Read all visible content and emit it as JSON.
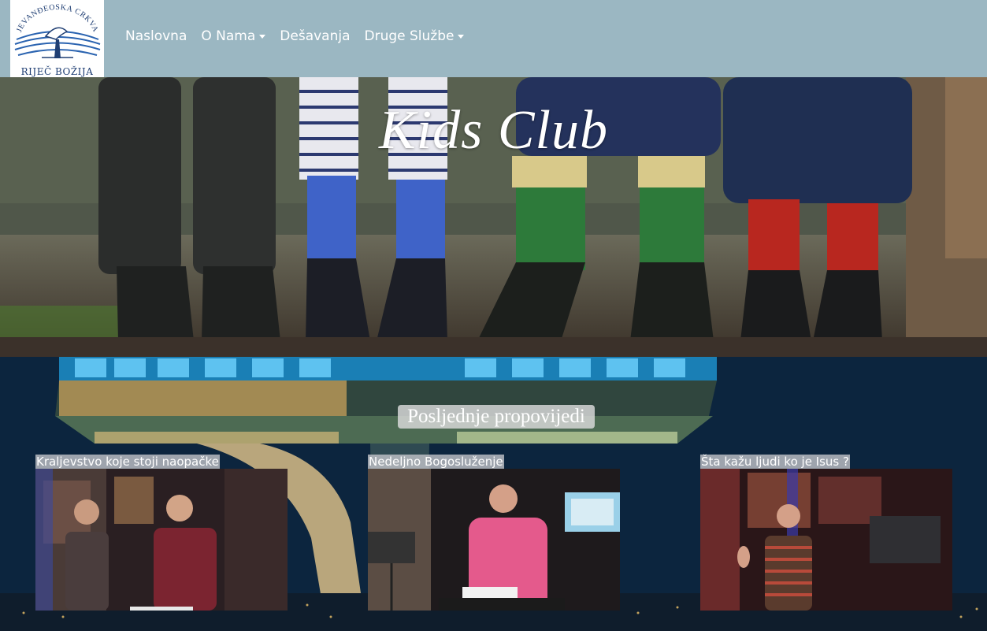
{
  "logo": {
    "arc_text": "JEVANĐEOSKA CRKVA",
    "bottom_text": "RIJEČ BOŽIJA"
  },
  "nav": {
    "items": [
      {
        "label": "Naslovna",
        "dropdown": false
      },
      {
        "label": "O Nama",
        "dropdown": true
      },
      {
        "label": "Dešavanja",
        "dropdown": false
      },
      {
        "label": "Druge Službe",
        "dropdown": true
      }
    ]
  },
  "hero": {
    "title": "Kids Club"
  },
  "sermons": {
    "heading": "Posljednje propovijedi",
    "items": [
      {
        "title": "Kraljevstvo koje stoji naopačke"
      },
      {
        "title": "Nedeljno Bogosluženje"
      },
      {
        "title": "Šta kažu ljudi ko je Isus ?"
      }
    ]
  },
  "colors": {
    "navbar": "#9bb7c2",
    "nav_text": "#ffffff",
    "section_bg": "#0d2238"
  }
}
